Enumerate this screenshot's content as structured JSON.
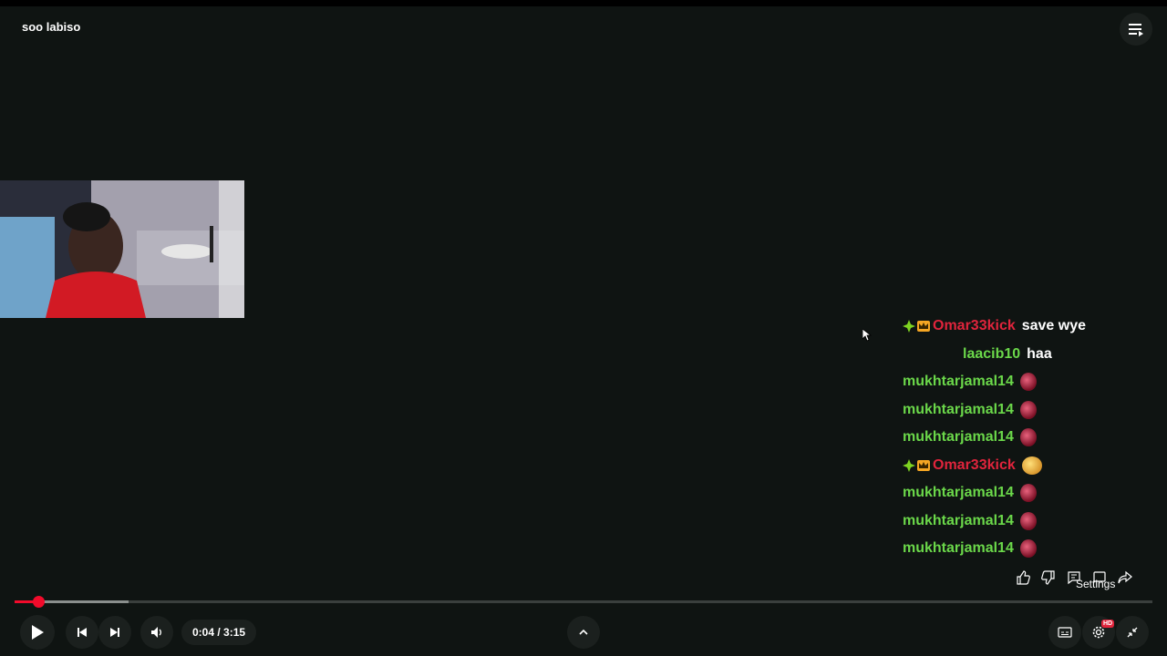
{
  "player": {
    "title": "soo labiso",
    "time_current": "0:04",
    "time_separator": " / ",
    "time_total": "3:15",
    "progress_fraction": 0.021,
    "buffer_fraction": 0.1,
    "settings_tooltip": "Settings",
    "hd_badge": "HD"
  },
  "chat": [
    {
      "user": "Omar33kick",
      "color": "red",
      "badges": [
        "diamond-badge-icon",
        "crown-badge-icon"
      ],
      "message": "save wye",
      "emote": ""
    },
    {
      "user": "laacib10",
      "color": "green",
      "badges": [],
      "message": "haa",
      "emote": ""
    },
    {
      "user": "mukhtarjamal14",
      "color": "green",
      "badges": [],
      "message": "",
      "emote": "red-ball-emote"
    },
    {
      "user": "mukhtarjamal14",
      "color": "green",
      "badges": [],
      "message": "",
      "emote": "red-ball-emote"
    },
    {
      "user": "mukhtarjamal14",
      "color": "green",
      "badges": [],
      "message": "",
      "emote": "red-ball-emote"
    },
    {
      "user": "Omar33kick",
      "color": "red",
      "badges": [
        "diamond-badge-icon",
        "crown-badge-icon"
      ],
      "message": "",
      "emote": "laughing-face-emote"
    },
    {
      "user": "mukhtarjamal14",
      "color": "green",
      "badges": [],
      "message": "",
      "emote": "red-ball-emote"
    },
    {
      "user": "mukhtarjamal14",
      "color": "green",
      "badges": [],
      "message": "",
      "emote": "red-ball-emote"
    },
    {
      "user": "mukhtarjamal14",
      "color": "green",
      "badges": [],
      "message": "",
      "emote": "red-ball-emote"
    }
  ],
  "colors": {
    "background": "#0f1412",
    "accent_red": "#f20b2b",
    "username_red": "#e0243c",
    "username_green": "#6bd84a"
  }
}
